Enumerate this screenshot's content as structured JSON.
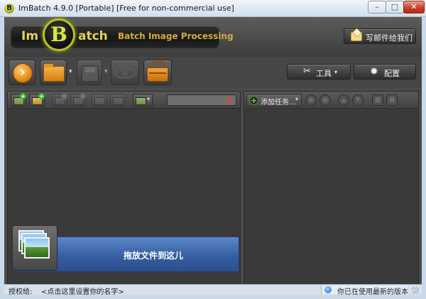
{
  "window": {
    "title": "ImBatch 4.9.0 [Portable] [Free for non-commercial use]",
    "app_icon_letter": "B",
    "minimize_glyph": "–",
    "maximize_glyph": "□",
    "close_glyph": "✕"
  },
  "header": {
    "logo_left": "Im",
    "logo_circle": "B",
    "logo_right": "atch",
    "subtitle": "Batch Image Processing",
    "write_mail_label": "写邮件给我们"
  },
  "toolbar": {
    "run_glyph": "›",
    "caret_glyph": "▾",
    "tools_label": "工具",
    "settings_label": "配置",
    "icons": [
      "run-icon",
      "open-folder-icon",
      "save-icon",
      "preview-eye-icon",
      "basket-icon",
      "wrench-icon",
      "gear-icon"
    ]
  },
  "files_panel": {
    "search_value": "",
    "clear_glyph": "✖",
    "drop_text": "拖放文件到这儿",
    "add_glyph": "+",
    "remove_glyph": "×"
  },
  "tasks_panel": {
    "add_task_label": "添加任务…",
    "add_glyph": "+"
  },
  "status": {
    "license_label": "授权给:",
    "license_hint": "<点击这里设置你的名字>",
    "version_text": "你已在使用最新的版本"
  },
  "colors": {
    "client_bg": "#4a4a4a",
    "panel_bg": "#3a3a3a",
    "logo_accent": "#b5c21c",
    "drop_zone": "#345d9e",
    "status_bg": "#d8e1ec"
  }
}
